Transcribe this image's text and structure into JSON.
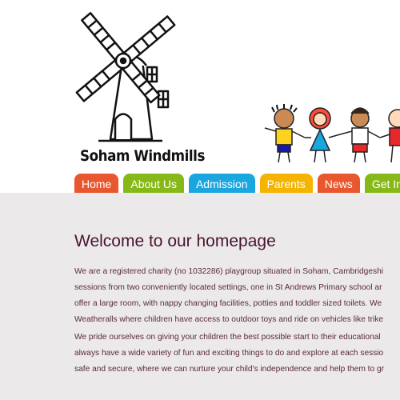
{
  "logo": {
    "text": "Soham Windmills",
    "icon": "windmill-icon"
  },
  "illustration": {
    "icon": "children-holding-hands-icon"
  },
  "nav": {
    "items": [
      {
        "label": "Home",
        "color": "#e8572e"
      },
      {
        "label": "About Us",
        "color": "#86b817"
      },
      {
        "label": "Admission",
        "color": "#1aa6df"
      },
      {
        "label": "Parents",
        "color": "#f5b400"
      },
      {
        "label": "News",
        "color": "#e8572e"
      },
      {
        "label": "Get Inv",
        "color": "#86b817"
      }
    ]
  },
  "main": {
    "title": "Welcome to our homepage",
    "paragraph1": [
      "We are a registered charity (no 1032286) playgroup situated in Soham, Cambridgeshi",
      "sessions from two conveniently located settings, one in St Andrews Primary school ar",
      "offer a large room, with nappy changing facilities, potties and toddler sized toilets. We",
      "Weatheralls where children have access to outdoor toys and ride on vehicles like trike"
    ],
    "paragraph2": [
      "We pride ourselves on giving your children the best possible start to their educational",
      "always have a wide variety of fun and exciting things to do and explore at each sessio",
      "safe and secure, where we can nurture your child's independence and help them to gr"
    ]
  },
  "colors": {
    "background": "#ebe9ea",
    "header": "#ffffff",
    "title": "#4a1430",
    "text": "#5b2a3c"
  }
}
